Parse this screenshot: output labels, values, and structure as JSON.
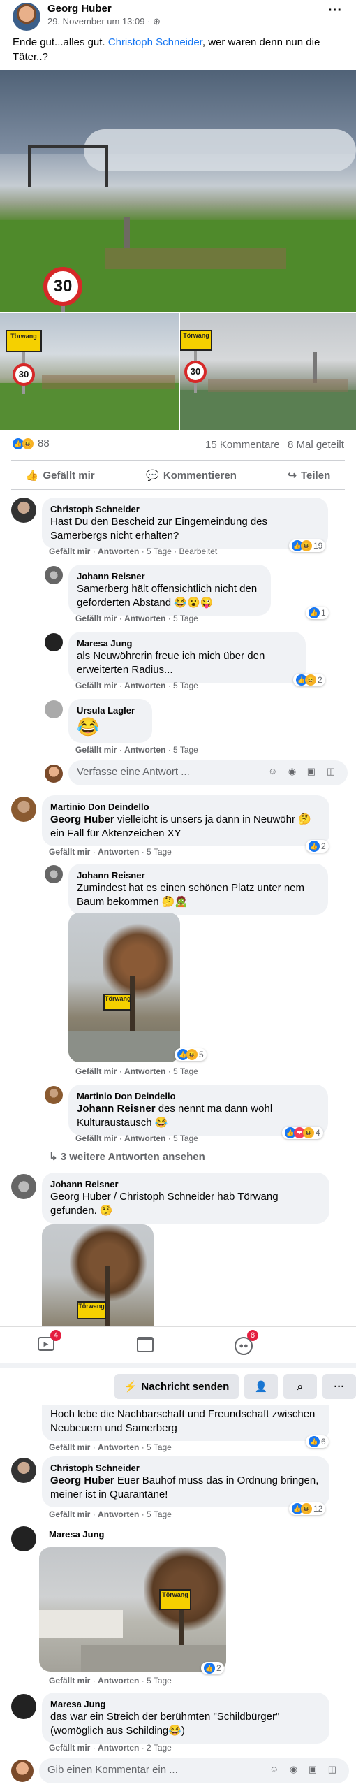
{
  "post": {
    "author": "Georg Huber",
    "date": "29. November um 13:09 · ",
    "text_before": "Ende gut...alles gut. ",
    "mention": "Christoph Schneider",
    "text_after": ", wer waren denn nun die Täter..?",
    "reactions_count": "88",
    "comments_count": "15 Kommentare",
    "shares_count": "8 Mal geteilt",
    "sign_town": "Törwang",
    "sign_speed": "30"
  },
  "action_bar": {
    "like": "Gefällt mir",
    "comment": "Kommentieren",
    "share": "Teilen"
  },
  "comments": [
    {
      "author": "Christoph Schneider",
      "text": "Hast Du den Bescheid zur Eingemeindung des Samerbergs nicht erhalten?",
      "like": "Gefällt mir",
      "reply": "Antworten",
      "time": "5 Tage",
      "edited": "Bearbeitet",
      "reactions": "19"
    },
    {
      "author": "Johann Reisner",
      "text": "Samerberg hält offensichtlich nicht den geforderten Abstand 😂😮😜",
      "like": "Gefällt mir",
      "reply": "Antworten",
      "time": "5 Tage",
      "reactions": "1"
    },
    {
      "author": "Maresa Jung",
      "text": "als Neuwöhrerin freue ich mich über den erweiterten Radius...",
      "like": "Gefällt mir",
      "reply": "Antworten",
      "time": "5 Tage",
      "reactions": "2"
    },
    {
      "author": "Ursula Lagler",
      "text": "😂",
      "like": "Gefällt mir",
      "reply": "Antworten",
      "time": "5 Tage"
    },
    {
      "author": "Martinio Don Deindello",
      "mention": "Georg Huber",
      "text": " vielleicht is unsers ja dann in Neuwöhr 🤔 ein Fall für Aktenzeichen XY",
      "like": "Gefällt mir",
      "reply": "Antworten",
      "time": "5 Tage",
      "reactions": "2"
    },
    {
      "author": "Johann Reisner",
      "text": "Zumindest hat es einen schönen Platz unter nem Baum bekommen 🤔🧟",
      "like": "Gefällt mir",
      "reply": "Antworten",
      "time": "5 Tage",
      "reactions": "5"
    },
    {
      "author": "Martinio Don Deindello",
      "mention": "Johann Reisner",
      "text": " des nennt ma dann wohl Kulturaustausch 😂",
      "like": "Gefällt mir",
      "reply": "Antworten",
      "time": "5 Tage",
      "reactions": "4"
    },
    {
      "author": "Johann Reisner",
      "text": "Georg Huber / Christoph Schneider hab Törwang gefunden. 🤥"
    },
    {
      "text": "Hoch lebe die Nachbarschaft und Freundschaft zwischen Neubeuern und Samerberg",
      "like": "Gefällt mir",
      "reply": "Antworten",
      "time": "5 Tage",
      "reactions": "6"
    },
    {
      "author": "Christoph Schneider",
      "mention": "Georg Huber",
      "text": " Euer Bauhof muss das in Ordnung bringen, meiner ist in Quarantäne!",
      "like": "Gefällt mir",
      "reply": "Antworten",
      "time": "5 Tage",
      "reactions": "12"
    },
    {
      "author": "Maresa Jung",
      "like": "Gefällt mir",
      "reply": "Antworten",
      "time": "5 Tage",
      "reactions": "2"
    },
    {
      "author": "Maresa Jung",
      "text": "das war ein Streich der berühmten \"Schildbürger\" (womöglich aus Schilding😂)",
      "like": "Gefällt mir",
      "reply": "Antworten",
      "time": "2 Tage"
    }
  ],
  "more_replies": "3 weitere Antworten ansehen",
  "reply_placeholder": "Verfasse eine Antwort ...",
  "comment_placeholder": "Gib einen Kommentar ein ...",
  "nav": {
    "video_badge": "4",
    "groups_badge": "8"
  },
  "toolbar": {
    "message": "Nachricht senden"
  }
}
